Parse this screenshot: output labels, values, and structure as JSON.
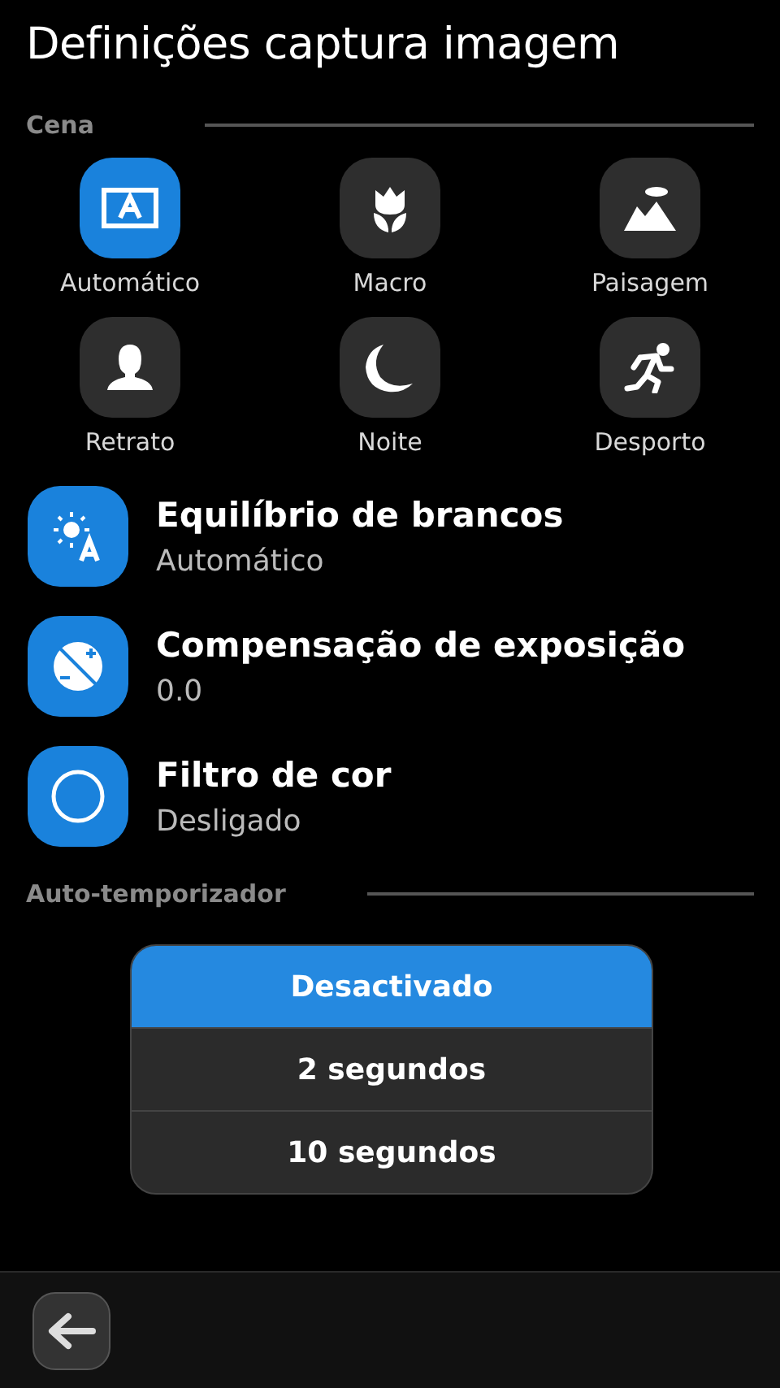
{
  "title": "Definições captura imagem",
  "scene_section": {
    "label": "Cena"
  },
  "scenes": [
    {
      "kind": "auto",
      "label": "Automático",
      "selected": true
    },
    {
      "kind": "macro",
      "label": "Macro",
      "selected": false
    },
    {
      "kind": "landscape",
      "label": "Paisagem",
      "selected": false
    },
    {
      "kind": "portrait",
      "label": "Retrato",
      "selected": false
    },
    {
      "kind": "night",
      "label": "Noite",
      "selected": false
    },
    {
      "kind": "sport",
      "label": "Desporto",
      "selected": false
    }
  ],
  "settings": [
    {
      "kind": "white_balance",
      "title": "Equilíbrio de brancos",
      "value": "Automático"
    },
    {
      "kind": "exposure",
      "title": "Compensação de exposição",
      "value": "0.0"
    },
    {
      "kind": "color_filter",
      "title": "Filtro de cor",
      "value": "Desligado"
    }
  ],
  "timer_section": {
    "label": "Auto-temporizador"
  },
  "timer_options": [
    {
      "label": "Desactivado",
      "selected": true
    },
    {
      "label": "2 segundos",
      "selected": false
    },
    {
      "label": "10 segundos",
      "selected": false
    }
  ]
}
